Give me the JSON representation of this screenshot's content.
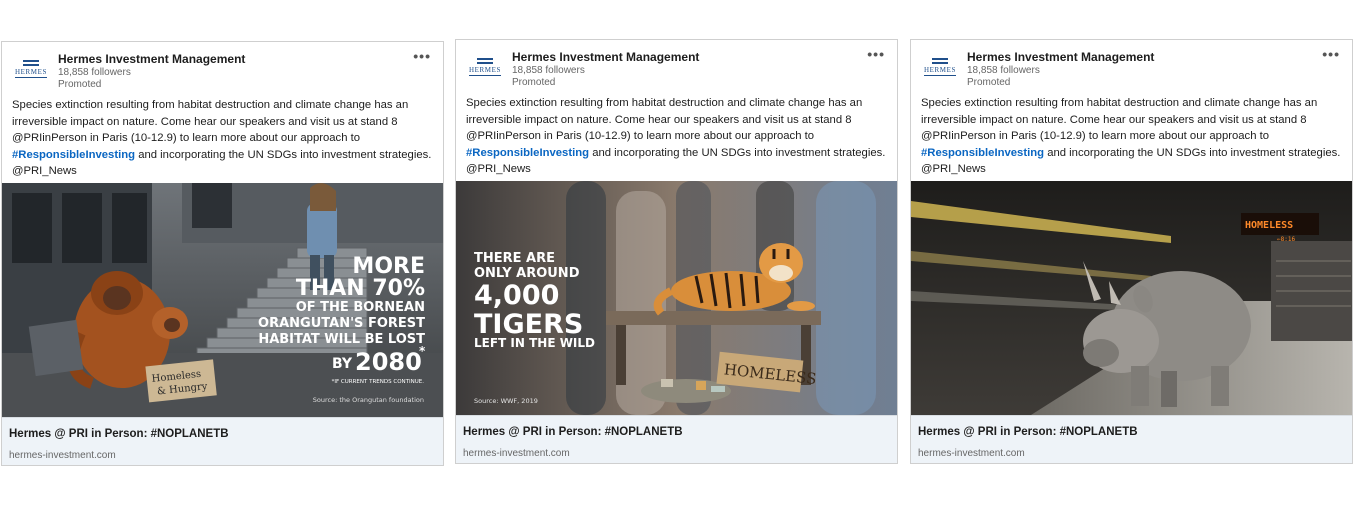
{
  "posts": [
    {
      "company": "Hermes Investment Management",
      "followers": "18,858 followers",
      "promoted": "Promoted",
      "menu": "•••",
      "logo_text": "HERMES",
      "text_before": "Species extinction resulting from habitat destruction and climate change has an irreversible impact on nature. Come hear our speakers and visit us at stand 8 @PRIinPerson in Paris (10-12.9) to learn more about our approach to",
      "hashtag": "#ResponsibleInvesting",
      "text_after": "and incorporating the UN SDGs into investment strategies. @PRI_News",
      "image": {
        "line1": "MORE",
        "line2": "THAN 70%",
        "line3": "OF THE BORNEAN",
        "line4": "ORANGUTAN'S FOREST",
        "line5": "HABITAT WILL BE LOST",
        "by": "BY",
        "year": "2080",
        "asterisk": "*",
        "footnote": "*IF CURRENT TRENDS CONTINUE.",
        "source": "Source: the Orangutan foundation",
        "sign_line1": "Homeless",
        "sign_line2": "& Hungry"
      },
      "link_title": "Hermes @ PRI in Person: #NOPLANETB",
      "link_url": "hermes-investment.com"
    },
    {
      "company": "Hermes Investment Management",
      "followers": "18,858 followers",
      "promoted": "Promoted",
      "menu": "•••",
      "logo_text": "HERMES",
      "text_before": "Species extinction resulting from habitat destruction and climate change has an irreversible impact on nature. Come hear our speakers and visit us at stand 8 @PRIinPerson in Paris (10-12.9) to learn more about our approach to",
      "hashtag": "#ResponsibleInvesting",
      "text_after": "and incorporating the UN SDGs into investment strategies. @PRI_News",
      "image": {
        "line1": "THERE ARE",
        "line2": "ONLY AROUND",
        "line3": "4,000",
        "line4": "TIGERS",
        "line5": "LEFT IN THE WILD",
        "source": "Source: WWF, 2019",
        "sign": "HOMELESS"
      },
      "link_title": "Hermes @ PRI in Person: #NOPLANETB",
      "link_url": "hermes-investment.com"
    },
    {
      "company": "Hermes Investment Management",
      "followers": "18,858 followers",
      "promoted": "Promoted",
      "menu": "•••",
      "logo_text": "HERMES",
      "text_before": "Species extinction resulting from habitat destruction and climate change has an irreversible impact on nature. Come hear our speakers and visit us at stand 8 @PRIinPerson in Paris (10-12.9) to learn more about our approach to",
      "hashtag": "#ResponsibleInvesting",
      "text_after": "and incorporating the UN SDGs into investment strategies. @PRI_News",
      "image": {
        "sign": "HOMELESS",
        "sign_arrow": "⇐8:16"
      },
      "link_title": "Hermes @ PRI in Person: #NOPLANETB",
      "link_url": "hermes-investment.com"
    }
  ],
  "colors": {
    "hashtag": "#0a66c2",
    "brand": "#1f4f8b",
    "footer_bg": "#eef3f8"
  }
}
